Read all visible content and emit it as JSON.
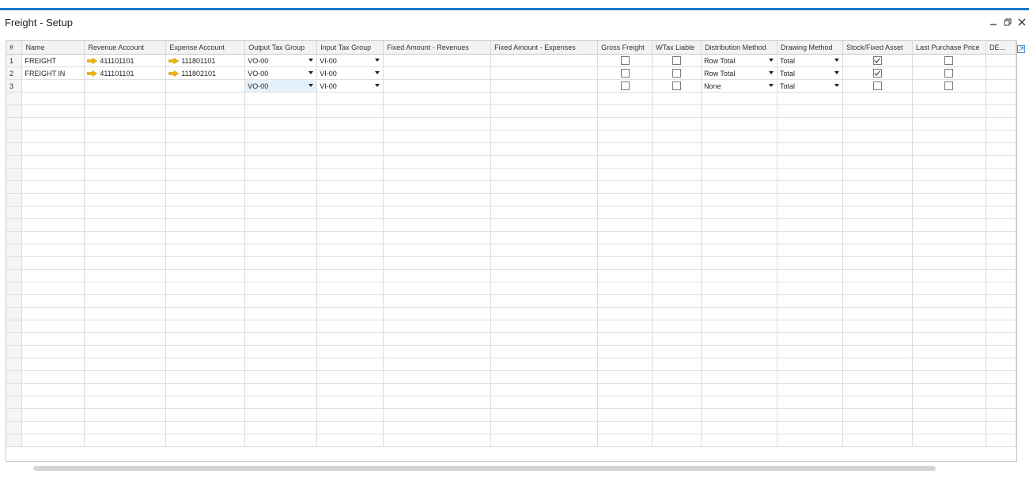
{
  "window": {
    "title": "Freight - Setup",
    "buttons": [
      "minimize-icon",
      "restore-icon",
      "close-icon"
    ]
  },
  "colors": {
    "accent": "#0a78c8",
    "arrow": "#f0b400"
  },
  "grid": {
    "columns": [
      "#",
      "Name",
      "Revenue Account",
      "Expense Account",
      "Output Tax Group",
      "Input Tax Group",
      "Fixed Amount - Revenues",
      "Fixed Amount - Expenses",
      "Gross Freight",
      "WTax Liable",
      "Distribution Method",
      "Drawing Method",
      "Stock/Fixed Asset",
      "Last Purchase Price",
      "DE..."
    ],
    "rows": [
      {
        "num": "1",
        "name": "FREIGHT",
        "revenue": "411101101",
        "expense": "111801101",
        "output_tax": "VO-00",
        "input_tax": "VI-00",
        "fixed_rev": "",
        "fixed_exp": "",
        "gross_freight": false,
        "wtax": false,
        "distribution": "Row Total",
        "drawing": "Total",
        "stock_fixed": true,
        "last_purchase": false
      },
      {
        "num": "2",
        "name": "FREIGHT IN",
        "revenue": "411101101",
        "expense": "111802101",
        "output_tax": "VO-00",
        "input_tax": "VI-00",
        "fixed_rev": "",
        "fixed_exp": "",
        "gross_freight": false,
        "wtax": false,
        "distribution": "Row Total",
        "drawing": "Total",
        "stock_fixed": true,
        "last_purchase": false
      },
      {
        "num": "3",
        "name": "",
        "revenue": "",
        "expense": "",
        "output_tax": "VO-00",
        "input_tax": "VI-00",
        "fixed_rev": "",
        "fixed_exp": "",
        "gross_freight": false,
        "wtax": false,
        "distribution": "None",
        "drawing": "Total",
        "stock_fixed": false,
        "last_purchase": false
      }
    ]
  }
}
